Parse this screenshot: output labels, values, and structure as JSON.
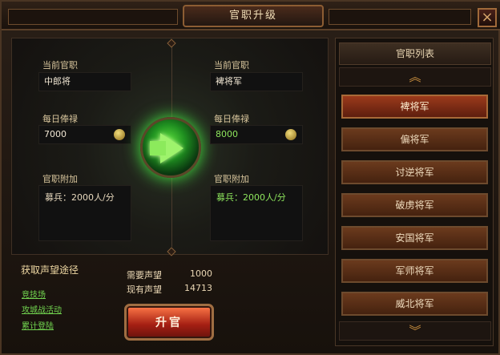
{
  "window": {
    "title": "官职升级",
    "close_label": "×"
  },
  "current": {
    "rank_label": "当前官职",
    "rank_value": "中郎将",
    "salary_label": "每日俸禄",
    "salary_value": "7000",
    "bonus_label": "官职附加",
    "bonus_value": "募兵：2000人/分"
  },
  "next": {
    "rank_label": "当前官职",
    "rank_value": "裨将军",
    "salary_label": "每日俸禄",
    "salary_value": "8000",
    "bonus_label": "官职附加",
    "bonus_value": "募兵：2000人/分"
  },
  "reputation": {
    "title": "获取声望途径",
    "links": [
      "竞技场",
      "攻城战活动",
      "累计登陆"
    ],
    "required_label": "需要声望",
    "required_value": "1000",
    "current_label": "现有声望",
    "current_value": "14713"
  },
  "upgrade_button": "升官",
  "rank_list": {
    "title": "官职列表",
    "up_arrow": "︽",
    "down_arrow": "︾",
    "items": [
      "裨将军",
      "偏将军",
      "讨逆将军",
      "破虏将军",
      "安国将军",
      "军师将军",
      "威北将军"
    ]
  },
  "icons": {
    "close": "close-icon",
    "salary": "coin-icon",
    "arrow": "green-right-arrow-icon",
    "list_up": "chevron-up-icon",
    "list_down": "chevron-down-icon"
  },
  "colors": {
    "accent_green": "#8ee65d",
    "button_red": "#a51f13",
    "bronze": "#9f6e42"
  }
}
